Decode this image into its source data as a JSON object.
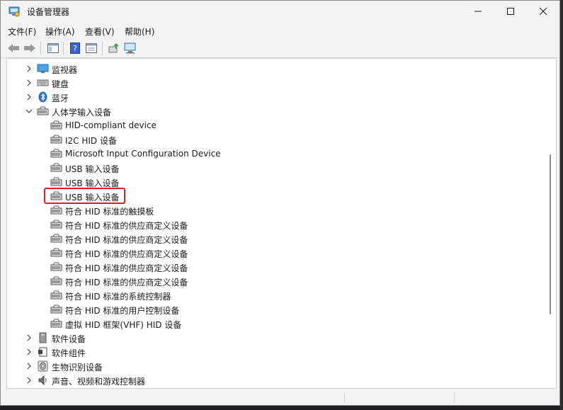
{
  "window": {
    "title": "设备管理器"
  },
  "menu": [
    {
      "label": "文件(F)"
    },
    {
      "label": "操作(A)"
    },
    {
      "label": "查看(V)"
    },
    {
      "label": "帮助(H)"
    }
  ],
  "tree": {
    "nodes": [
      {
        "label": "监视器",
        "icon": "monitor-icon",
        "expander": "collapsed"
      },
      {
        "label": "键盘",
        "icon": "keyboard-icon",
        "expander": "collapsed"
      },
      {
        "label": "蓝牙",
        "icon": "bluetooth-icon",
        "expander": "collapsed"
      },
      {
        "label": "人体学输入设备",
        "icon": "hid-icon",
        "expander": "expanded"
      },
      {
        "label": "HID-compliant device",
        "icon": "hid-icon"
      },
      {
        "label": "I2C HID 设备",
        "icon": "hid-icon"
      },
      {
        "label": "Microsoft Input Configuration Device",
        "icon": "hid-icon"
      },
      {
        "label": "USB 输入设备",
        "icon": "hid-icon"
      },
      {
        "label": "USB 输入设备",
        "icon": "hid-icon"
      },
      {
        "label": "USB 输入设备",
        "icon": "hid-icon",
        "highlighted": true
      },
      {
        "label": "符合 HID 标准的触摸板",
        "icon": "hid-icon"
      },
      {
        "label": "符合 HID 标准的供应商定义设备",
        "icon": "hid-icon"
      },
      {
        "label": "符合 HID 标准的供应商定义设备",
        "icon": "hid-icon"
      },
      {
        "label": "符合 HID 标准的供应商定义设备",
        "icon": "hid-icon"
      },
      {
        "label": "符合 HID 标准的供应商定义设备",
        "icon": "hid-icon"
      },
      {
        "label": "符合 HID 标准的供应商定义设备",
        "icon": "hid-icon"
      },
      {
        "label": "符合 HID 标准的系统控制器",
        "icon": "hid-icon"
      },
      {
        "label": "符合 HID 标准的用户控制设备",
        "icon": "hid-icon"
      },
      {
        "label": "虚拟 HID 框架(VHF) HID 设备",
        "icon": "hid-icon"
      },
      {
        "label": "软件设备",
        "icon": "software-device-icon",
        "expander": "collapsed"
      },
      {
        "label": "软件组件",
        "icon": "software-component-icon",
        "expander": "collapsed"
      },
      {
        "label": "生物识别设备",
        "icon": "biometric-icon",
        "expander": "collapsed"
      },
      {
        "label": "声音、视频和游戏控制器",
        "icon": "sound-icon",
        "expander": "collapsed"
      }
    ]
  },
  "colors": {
    "highlight_border": "#e01e1e",
    "window_bg": "#f3f3f3",
    "tree_bg": "#ffffff"
  }
}
